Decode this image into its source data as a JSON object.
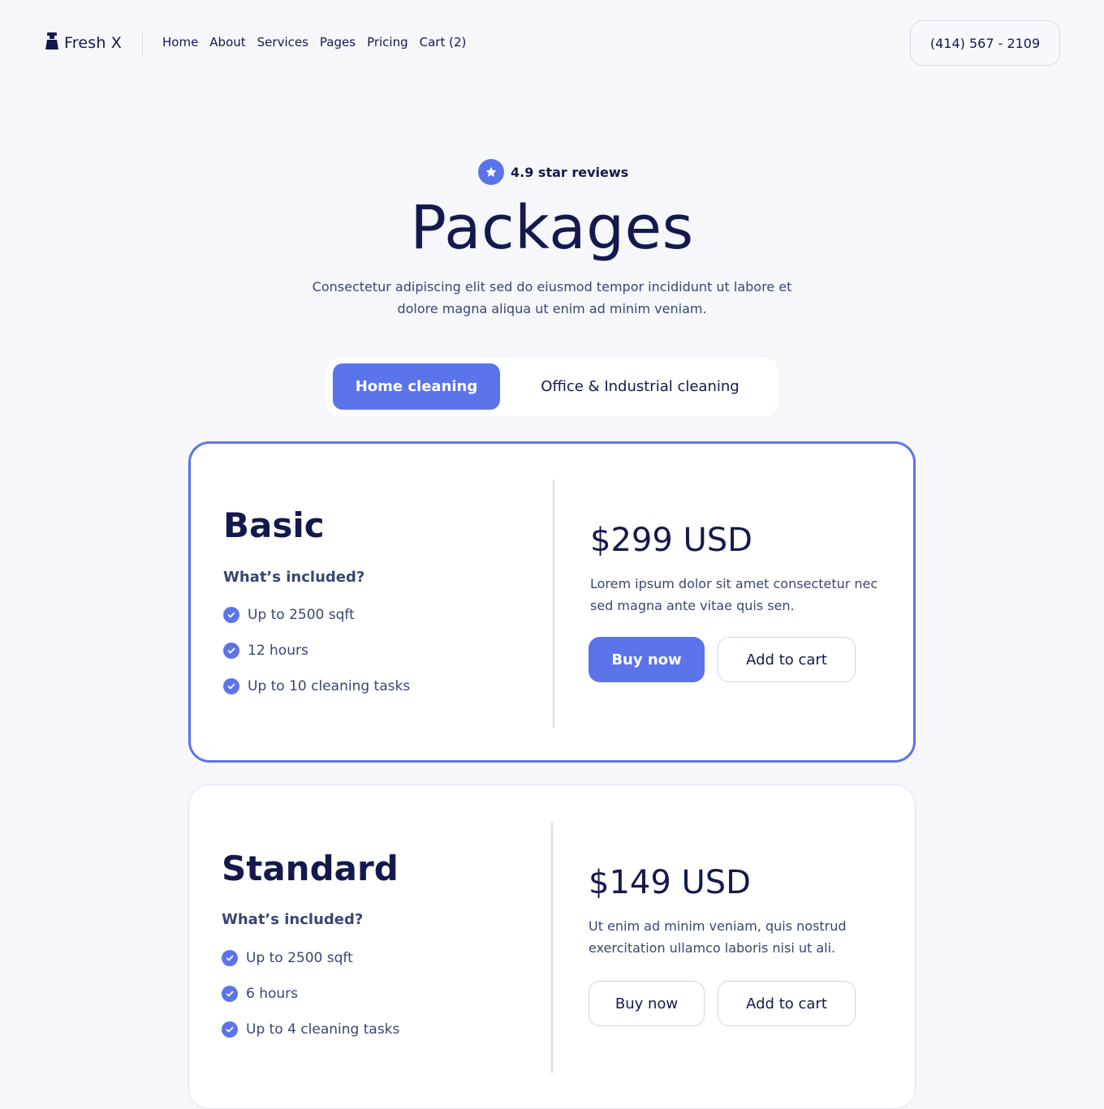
{
  "header": {
    "logo_text": "Fresh X",
    "nav": [
      "Home",
      "About",
      "Services",
      "Pages",
      "Pricing",
      "Cart (2)"
    ],
    "phone": "(414) 567 - 2109"
  },
  "hero": {
    "rating": "4.9 star reviews",
    "title": "Packages",
    "subtitle": "Consectetur adipiscing elit sed do eiusmod tempor incididunt ut labore et dolore magna aliqua ut enim ad minim veniam."
  },
  "tabs": {
    "active": "Home cleaning",
    "inactive": "Office & Industrial cleaning"
  },
  "plans": [
    {
      "name": "Basic",
      "included_label": "What’s included?",
      "features": [
        "Up to 2500 sqft",
        "12 hours",
        "Up to 10 cleaning tasks"
      ],
      "price": "$299 USD",
      "description": "Lorem ipsum dolor sit amet consectetur nec sed magna ante vitae quis sen.",
      "buy_label": "Buy now",
      "cart_label": "Add to cart"
    },
    {
      "name": "Standard",
      "included_label": "What’s included?",
      "features": [
        "Up to 2500 sqft",
        "6 hours",
        "Up to 4 cleaning tasks"
      ],
      "price": "$149 USD",
      "description": "Ut enim ad minim veniam, quis nostrud exercitation ullamco laboris nisi ut ali.",
      "buy_label": "Buy now",
      "cart_label": "Add to cart"
    }
  ],
  "colors": {
    "accent": "#5b74ea",
    "text_dark": "#14194d",
    "text_body": "#3a4573",
    "background": "#f5f7fb"
  }
}
